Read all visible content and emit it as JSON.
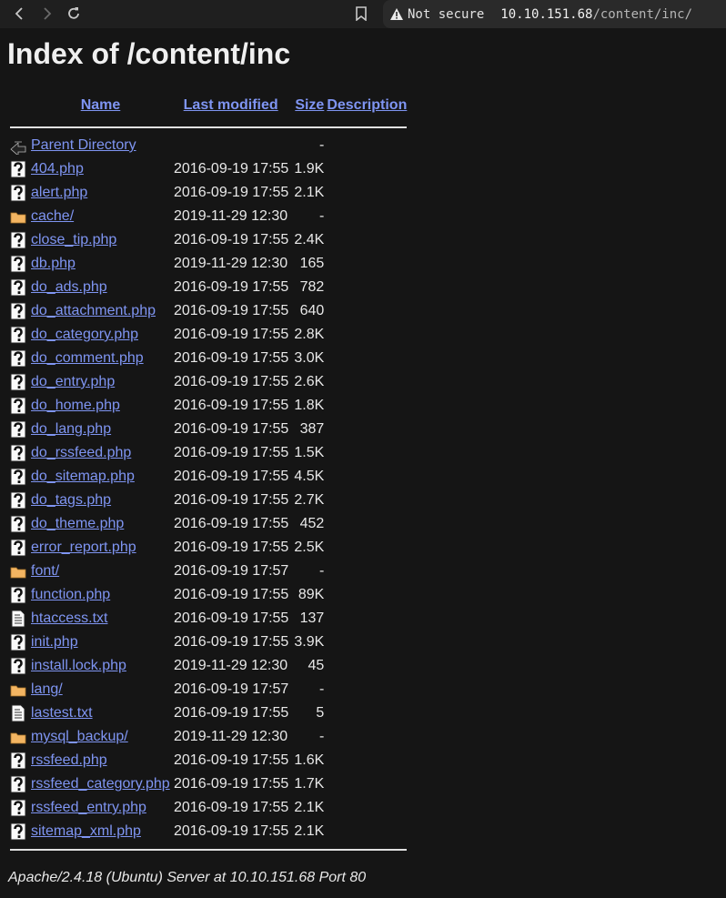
{
  "browser": {
    "not_secure": "Not secure",
    "url_host": "10.10.151.68",
    "url_path": "/content/inc/"
  },
  "page": {
    "title": "Index of /content/inc",
    "headers": {
      "name": "Name",
      "last_modified": "Last modified",
      "size": "Size",
      "description": "Description"
    },
    "rows": [
      {
        "icon": "back-icon",
        "name": "Parent Directory",
        "modified": "",
        "size": "-"
      },
      {
        "icon": "unknown-file-icon",
        "name": "404.php",
        "modified": "2016-09-19 17:55",
        "size": "1.9K"
      },
      {
        "icon": "unknown-file-icon",
        "name": "alert.php",
        "modified": "2016-09-19 17:55",
        "size": "2.1K"
      },
      {
        "icon": "folder-icon",
        "name": "cache/",
        "modified": "2019-11-29 12:30",
        "size": "-"
      },
      {
        "icon": "unknown-file-icon",
        "name": "close_tip.php",
        "modified": "2016-09-19 17:55",
        "size": "2.4K"
      },
      {
        "icon": "unknown-file-icon",
        "name": "db.php",
        "modified": "2019-11-29 12:30",
        "size": "165"
      },
      {
        "icon": "unknown-file-icon",
        "name": "do_ads.php",
        "modified": "2016-09-19 17:55",
        "size": "782"
      },
      {
        "icon": "unknown-file-icon",
        "name": "do_attachment.php",
        "modified": "2016-09-19 17:55",
        "size": "640"
      },
      {
        "icon": "unknown-file-icon",
        "name": "do_category.php",
        "modified": "2016-09-19 17:55",
        "size": "2.8K"
      },
      {
        "icon": "unknown-file-icon",
        "name": "do_comment.php",
        "modified": "2016-09-19 17:55",
        "size": "3.0K"
      },
      {
        "icon": "unknown-file-icon",
        "name": "do_entry.php",
        "modified": "2016-09-19 17:55",
        "size": "2.6K"
      },
      {
        "icon": "unknown-file-icon",
        "name": "do_home.php",
        "modified": "2016-09-19 17:55",
        "size": "1.8K"
      },
      {
        "icon": "unknown-file-icon",
        "name": "do_lang.php",
        "modified": "2016-09-19 17:55",
        "size": "387"
      },
      {
        "icon": "unknown-file-icon",
        "name": "do_rssfeed.php",
        "modified": "2016-09-19 17:55",
        "size": "1.5K"
      },
      {
        "icon": "unknown-file-icon",
        "name": "do_sitemap.php",
        "modified": "2016-09-19 17:55",
        "size": "4.5K"
      },
      {
        "icon": "unknown-file-icon",
        "name": "do_tags.php",
        "modified": "2016-09-19 17:55",
        "size": "2.7K"
      },
      {
        "icon": "unknown-file-icon",
        "name": "do_theme.php",
        "modified": "2016-09-19 17:55",
        "size": "452"
      },
      {
        "icon": "unknown-file-icon",
        "name": "error_report.php",
        "modified": "2016-09-19 17:55",
        "size": "2.5K"
      },
      {
        "icon": "folder-icon",
        "name": "font/",
        "modified": "2016-09-19 17:57",
        "size": "-"
      },
      {
        "icon": "unknown-file-icon",
        "name": "function.php",
        "modified": "2016-09-19 17:55",
        "size": "89K"
      },
      {
        "icon": "text-file-icon",
        "name": "htaccess.txt",
        "modified": "2016-09-19 17:55",
        "size": "137"
      },
      {
        "icon": "unknown-file-icon",
        "name": "init.php",
        "modified": "2016-09-19 17:55",
        "size": "3.9K"
      },
      {
        "icon": "unknown-file-icon",
        "name": "install.lock.php",
        "modified": "2019-11-29 12:30",
        "size": "45"
      },
      {
        "icon": "folder-icon",
        "name": "lang/",
        "modified": "2016-09-19 17:57",
        "size": "-"
      },
      {
        "icon": "text-file-icon",
        "name": "lastest.txt",
        "modified": "2016-09-19 17:55",
        "size": "5"
      },
      {
        "icon": "folder-icon",
        "name": "mysql_backup/",
        "modified": "2019-11-29 12:30",
        "size": "-"
      },
      {
        "icon": "unknown-file-icon",
        "name": "rssfeed.php",
        "modified": "2016-09-19 17:55",
        "size": "1.6K"
      },
      {
        "icon": "unknown-file-icon",
        "name": "rssfeed_category.php",
        "modified": "2016-09-19 17:55",
        "size": "1.7K"
      },
      {
        "icon": "unknown-file-icon",
        "name": "rssfeed_entry.php",
        "modified": "2016-09-19 17:55",
        "size": "2.1K"
      },
      {
        "icon": "unknown-file-icon",
        "name": "sitemap_xml.php",
        "modified": "2016-09-19 17:55",
        "size": "2.1K"
      }
    ],
    "footer": "Apache/2.4.18 (Ubuntu) Server at 10.10.151.68 Port 80"
  },
  "colors": {
    "link": "#7f95f2",
    "background": "#151515",
    "folder": "#f3b562"
  }
}
